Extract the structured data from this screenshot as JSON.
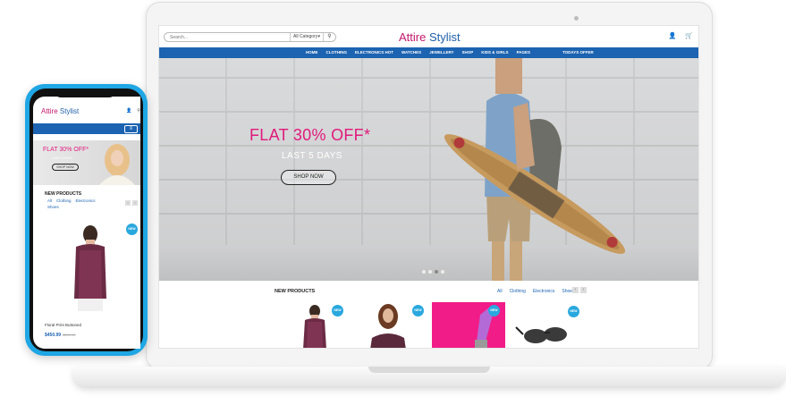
{
  "brand": {
    "part1": "Attire",
    "part2": "Stylist"
  },
  "colors": {
    "pink": "#e01a7c",
    "blue": "#1c63b1",
    "badge": "#29a8de"
  },
  "desktop": {
    "search": {
      "placeholder": "Search...",
      "category": "All Category"
    },
    "icons": [
      "user-icon",
      "cart-icon",
      "search-icon"
    ],
    "nav": [
      "HOME",
      "CLOTHING",
      "ELECTRONICS HOT",
      "WATCHES",
      "JEWELLERY",
      "SHOP",
      "KIDS & GIRLS",
      "PAGES"
    ],
    "nav_offer": "TODAYS OFFER",
    "hero": {
      "title": "FLAT 30% OFF*",
      "subtitle": "LAST 5 DAYS",
      "button": "SHOP NOW"
    },
    "new_products": {
      "title": "NEW PRODUCTS",
      "tabs": [
        "All",
        "Clothing",
        "Electronics",
        "Shoes"
      ],
      "badge": "NEW"
    }
  },
  "mobile": {
    "banner": {
      "title": "FLAT 30% OFF*",
      "subtitle": "LAST 5 DAYS",
      "button": "SHOP NOW"
    },
    "new_products": {
      "title": "NEW PRODUCTS",
      "tabs": [
        "All",
        "Clothing",
        "Electronics"
      ],
      "tab_shoes": "Shoes",
      "badge": "NEW"
    },
    "product": {
      "name": "Floral Print Buttoned",
      "price": "$450.99",
      "old_price": "$500.00"
    }
  }
}
